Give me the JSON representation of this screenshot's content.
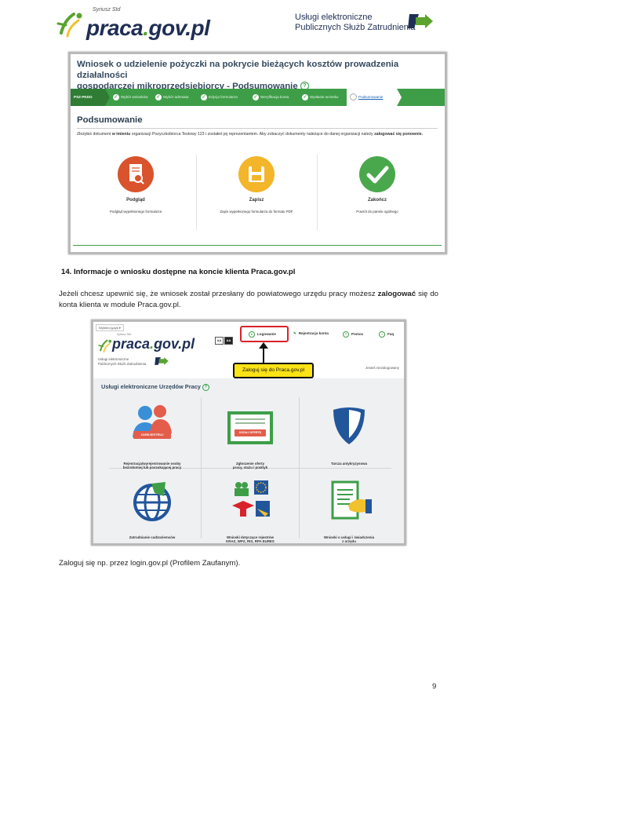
{
  "header": {
    "logo_superscript": "Syriusz Std",
    "logo_text_main": "praca",
    "logo_text_dot": ".",
    "logo_text_tail": "gov.pl",
    "service_line1": "Usługi elektroniczne",
    "service_line2": "Publicznych Służb Zatrudnienia",
    "service_icon": "pss-brand-icon"
  },
  "screenshot1": {
    "title_line1": "Wniosek o udzielenie pożyczki na pokrycie bieżących kosztów prowadzenia działalności",
    "title_line2": "gospodarczej mikroprzedsiębiorcy - Podsumowanie",
    "help_icon": "?",
    "steps": [
      {
        "label": "PSZ-PKDG",
        "state": "first"
      },
      {
        "label": "Wybór wniosków",
        "state": "done"
      },
      {
        "label": "Wybór adresata",
        "state": "done"
      },
      {
        "label": "Edycja formularza",
        "state": "done"
      },
      {
        "label": "Weryfikacja konta",
        "state": "done"
      },
      {
        "label": "Wysłanie wniosku",
        "state": "done"
      },
      {
        "label": "Podsumowanie",
        "state": "active"
      }
    ],
    "heading": "Podsumowanie",
    "description_pre": "Złożyłeś dokument ",
    "description_b1": "w imieniu",
    "description_mid": " organizacji Pozyczkobiorca Testowy 123 i zostałeś jej reprezentantem. Aby zobaczyć dokumenty należące do danej organizacji należy ",
    "description_b2": "zalogować się ponownie.",
    "actions": [
      {
        "icon": "preview-document-icon",
        "label": "Podgląd",
        "sub": "Podgląd wypełnionego formularza",
        "color": "#d9532c"
      },
      {
        "icon": "save-floppy-icon",
        "label": "Zapisz",
        "sub": "Zapis wypełnionego formularza do formatu PDF",
        "color": "#f3b52a"
      },
      {
        "icon": "checkmark-icon",
        "label": "Zakończ",
        "sub": "Powrót do panelu ogólnego",
        "color": "#49a84c"
      }
    ]
  },
  "section_heading": "14. Informacje o wniosku dostępne na koncie klienta Praca.gov.pl",
  "paragraph1_pre": "Jeżeli chcesz upewnić się, że wniosek został przesłany do powiatowego urzędu pracy możesz ",
  "paragraph1_bold": "zalogować",
  "paragraph1_post": " się do konta klienta w module Praca.gov.pl.",
  "screenshot2": {
    "lang_select": "Wybierz język",
    "logo_sup": "Syriusz Std",
    "logo_main": "praca",
    "logo_dot": ".",
    "logo_tail": "gov.pl",
    "sub_line1": "Usługi elektroniczne",
    "sub_line2": "Publicznych Służb Zatrudnienia",
    "font_a_small": "AA",
    "font_a_large": "AA",
    "nav": [
      {
        "icon": "user-icon",
        "label": "Logowanie"
      },
      {
        "icon": "pencil-icon",
        "label": "Rejestracja konta"
      },
      {
        "icon": "help-icon",
        "label": "Pomoc"
      },
      {
        "icon": "faq-icon",
        "label": "Faq"
      }
    ],
    "callout": "Zaloguj się do Praca.gov.pl",
    "not_logged": "Jesteś niezalogowany",
    "heading": "Usługi elektroniczne Urzędów Pracy",
    "register_button": "ZAREJESTRUJ",
    "offer_button": "DODAJ OFERTĘ",
    "tiles": [
      {
        "icon": "people-register-icon",
        "line1": "Rejestracja/wyrejestrowanie osoby",
        "line2": "bezrobotnej lub poszukującej pracy"
      },
      {
        "icon": "job-offer-icon",
        "line1": "Zgłoszenie oferty",
        "line2": "pracy, stażu i praktyk"
      },
      {
        "icon": "shield-icon",
        "line1": "Tarcza antykryzysowa",
        "line2": ""
      },
      {
        "icon": "globe-icon",
        "line1": "Zatrudnianie cudzoziemców",
        "line2": ""
      },
      {
        "icon": "registers-icon",
        "line1": "Wnioski dotyczące rejestrów",
        "line2": "KRAZ, WPZ, RIS, RPA EURES"
      },
      {
        "icon": "document-hand-icon",
        "line1": "Wnioski o usługi i świadczenia",
        "line2": "z urzędu"
      }
    ]
  },
  "paragraph2": "Zaloguj się np. przez login.gov.pl (Profilem Zaufanym).",
  "page_number": "9"
}
